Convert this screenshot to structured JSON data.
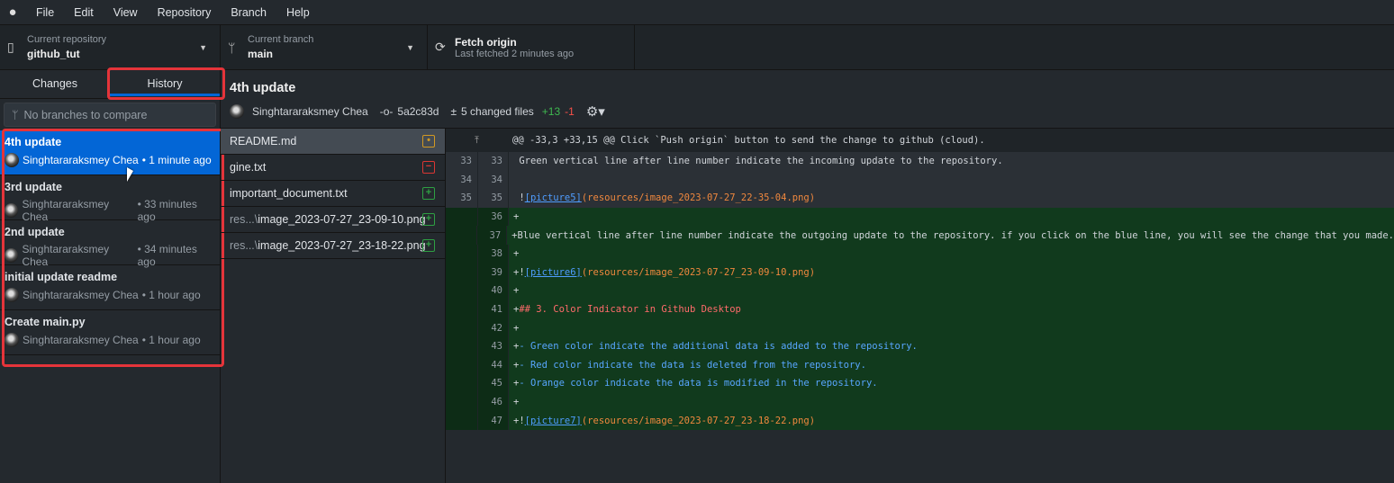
{
  "menu": [
    "File",
    "Edit",
    "View",
    "Repository",
    "Branch",
    "Help"
  ],
  "toolbar": {
    "repo_label": "Current repository",
    "repo": "github_tut",
    "branch_label": "Current branch",
    "branch": "main",
    "fetch": "Fetch origin",
    "fetched": "Last fetched 2 minutes ago"
  },
  "tabs": {
    "changes": "Changes",
    "history": "History"
  },
  "compare_placeholder": "No branches to compare",
  "commits": [
    {
      "title": "4th update",
      "author": "Singhtararaksmey Chea",
      "time": "• 1 minute ago"
    },
    {
      "title": "3rd update",
      "author": "Singhtararaksmey Chea",
      "time": "• 33 minutes ago"
    },
    {
      "title": "2nd update",
      "author": "Singhtararaksmey Chea",
      "time": "• 34 minutes ago"
    },
    {
      "title": "initial update readme",
      "author": "Singhtararaksmey Chea",
      "time": "• 1 hour ago"
    },
    {
      "title": "Create main.py",
      "author": "Singhtararaksmey Chea",
      "time": "• 1 hour ago"
    }
  ],
  "detail": {
    "title": "4th update",
    "author": "Singhtararaksmey Chea",
    "sha": "5a2c83d",
    "changed": "5 changed files",
    "added": "+13",
    "removed": "-1"
  },
  "files": [
    {
      "prefix": "",
      "name": "README.md",
      "status": "modified"
    },
    {
      "prefix": "",
      "name": "gine.txt",
      "status": "deleted"
    },
    {
      "prefix": "",
      "name": "important_document.txt",
      "status": "added"
    },
    {
      "prefix": "res...\\",
      "name": "image_2023-07-27_23-09-10.png",
      "status": "added"
    },
    {
      "prefix": "res...\\",
      "name": "image_2023-07-27_23-18-22.png",
      "status": "added"
    }
  ],
  "colors": {
    "accent": "#0366d6",
    "added": "#2ea043",
    "deleted": "#da3633",
    "modified": "#d29922",
    "highlight": "#e5343a"
  },
  "diff": {
    "hunk": "@@ -33,3 +33,15 @@ Click `Push origin` button to send the change to github (cloud).",
    "lines": [
      {
        "o": "33",
        "n": "33",
        "t": "ctx",
        "text": " Green vertical line after line number indicate the incoming update to the repository."
      },
      {
        "o": "34",
        "n": "34",
        "t": "ctx",
        "text": ""
      },
      {
        "o": "35",
        "n": "35",
        "t": "ctx",
        "pre": " !",
        "link": "[picture5]",
        "path": "(resources/image_2023-07-27_22-35-04.png)"
      },
      {
        "o": "",
        "n": "36",
        "t": "add",
        "text": "+"
      },
      {
        "o": "",
        "n": "37",
        "t": "add",
        "text": "+Blue vertical line after line number indicate the outgoing update to the repository. if you click on the blue line, you will see the change that you made."
      },
      {
        "o": "",
        "n": "38",
        "t": "add",
        "text": "+"
      },
      {
        "o": "",
        "n": "39",
        "t": "add",
        "pre": "+!",
        "link": "[picture6]",
        "path": "(resources/image_2023-07-27_23-09-10.png)"
      },
      {
        "o": "",
        "n": "40",
        "t": "add",
        "text": "+"
      },
      {
        "o": "",
        "n": "41",
        "t": "add",
        "pre": "+",
        "heading": "## 3. Color Indicator in Github Desktop"
      },
      {
        "o": "",
        "n": "42",
        "t": "add",
        "text": "+"
      },
      {
        "o": "",
        "n": "43",
        "t": "add",
        "pre": "+",
        "list": "- Green color indicate the additional data is added to the repository."
      },
      {
        "o": "",
        "n": "44",
        "t": "add",
        "pre": "+",
        "list": "- Red color indicate the data is deleted from the repository."
      },
      {
        "o": "",
        "n": "45",
        "t": "add",
        "pre": "+",
        "list": "- Orange color indicate the data is modified in the repository."
      },
      {
        "o": "",
        "n": "46",
        "t": "add",
        "text": "+"
      },
      {
        "o": "",
        "n": "47",
        "t": "add",
        "pre": "+!",
        "link": "[picture7]",
        "path": "(resources/image_2023-07-27_23-18-22.png)"
      }
    ]
  }
}
